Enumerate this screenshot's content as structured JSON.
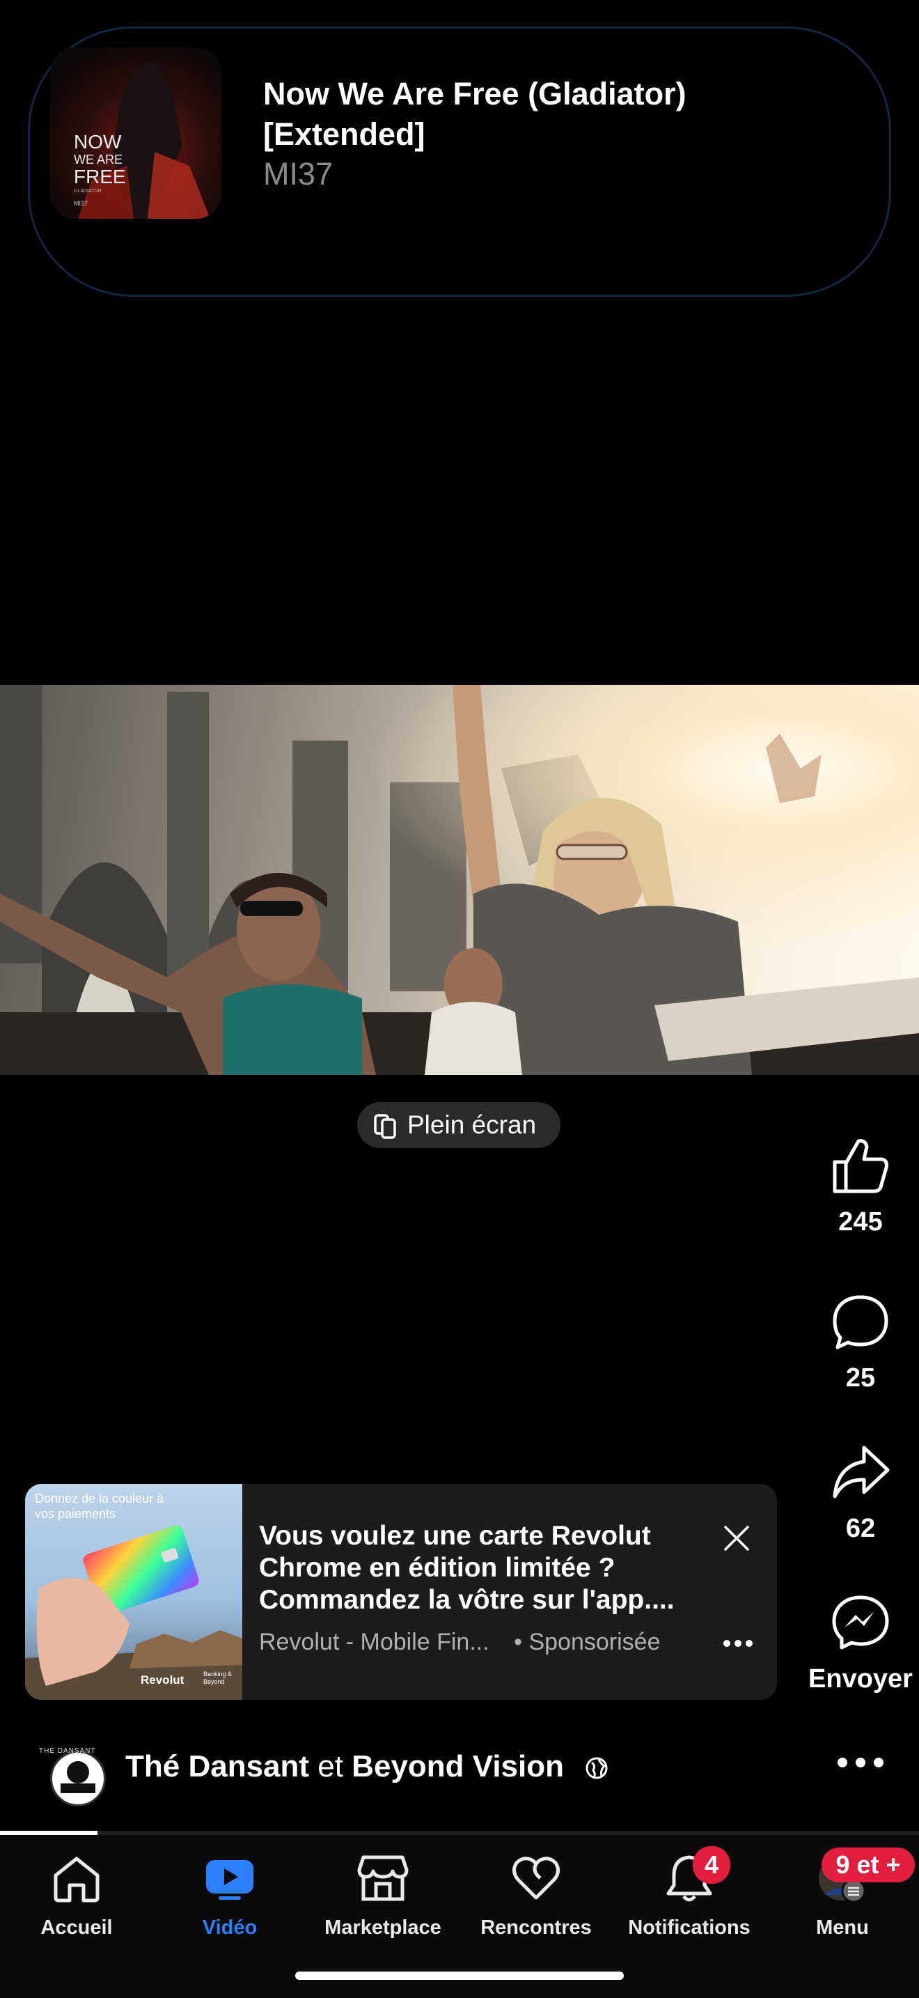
{
  "now_playing": {
    "title": "Now We Are Free (Gladiator) [Extended]",
    "artist": "MI37",
    "art_text": [
      "NOW",
      "WE ARE",
      "FREE",
      "GLADIATOR",
      "MI37"
    ]
  },
  "video": {
    "fullscreen_label": "Plein écran"
  },
  "actions": {
    "like_count": "245",
    "comment_count": "25",
    "share_count": "62",
    "send_label": "Envoyer"
  },
  "ad": {
    "image_caption": "Donnez de la couleur à vos paiements",
    "image_brand": "Revolut",
    "image_tagline": "Banking & Beyond",
    "headline": "Vous voulez une carte Revolut Chrome en édition limitée ? Commandez la vôtre sur l'app....",
    "source": "Revolut - Mobile Fin...",
    "sponsored": "• Sponsorisée"
  },
  "author": {
    "avatar_text": "THÉ DANSANT",
    "name1": "Thé Dansant",
    "conj": " et ",
    "name2": "Beyond Vision"
  },
  "nav": {
    "items": [
      {
        "label": "Accueil"
      },
      {
        "label": "Vidéo"
      },
      {
        "label": "Marketplace"
      },
      {
        "label": "Rencontres"
      },
      {
        "label": "Notifications",
        "badge": "4"
      },
      {
        "label": "Menu",
        "badge": "9 et +"
      }
    ]
  },
  "colors": {
    "accent": "#2d7ff9",
    "badge": "#e41e3f",
    "background": "#000000"
  }
}
